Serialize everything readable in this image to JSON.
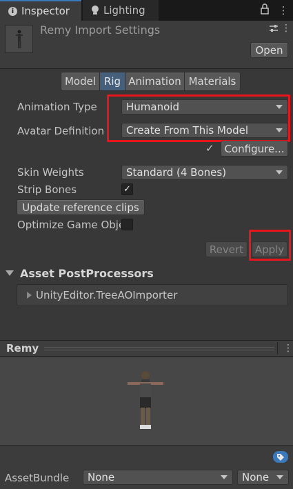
{
  "tabs": [
    {
      "label": "Inspector",
      "icon": "info-icon",
      "active": true
    },
    {
      "label": "Lighting",
      "icon": "lightbulb-icon",
      "active": false
    }
  ],
  "header": {
    "title": "Remy Import Settings",
    "open_label": "Open"
  },
  "toolbar": {
    "tabs": [
      "Model",
      "Rig",
      "Animation",
      "Materials"
    ],
    "selected": "Rig"
  },
  "rig": {
    "animation_type_label": "Animation Type",
    "animation_type_value": "Humanoid",
    "avatar_definition_label": "Avatar Definition",
    "avatar_definition_value": "Create From This Model",
    "configure_label": "Configure...",
    "configure_check": "✓",
    "skin_weights_label": "Skin Weights",
    "skin_weights_value": "Standard (4 Bones)",
    "strip_bones_label": "Strip Bones",
    "strip_bones_checked": true,
    "update_clips_label": "Update reference clips",
    "optimize_label": "Optimize Game Obje",
    "optimize_checked": false,
    "revert_label": "Revert",
    "apply_label": "Apply"
  },
  "postprocessors": {
    "title": "Asset PostProcessors",
    "items": [
      "UnityEditor.TreeAOImporter"
    ]
  },
  "preview": {
    "title": "Remy"
  },
  "assetbundle": {
    "label": "AssetBundle",
    "name_value": "None",
    "variant_value": "None"
  },
  "colors": {
    "highlight": "#e8161c",
    "selected_tab": "#46607c",
    "accent": "#3a79bb"
  }
}
